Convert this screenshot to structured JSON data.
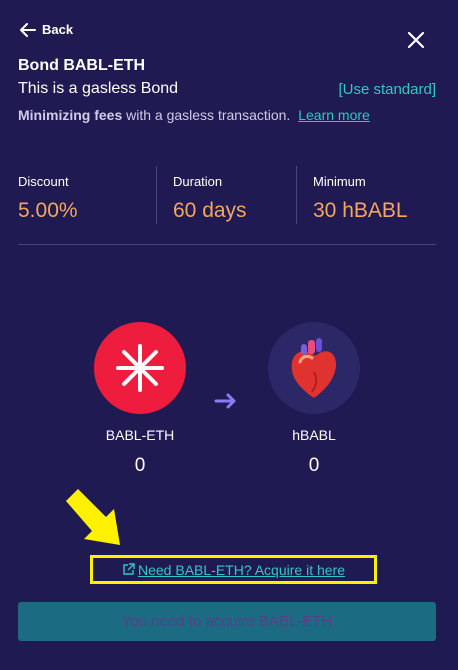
{
  "header": {
    "back_label": "Back",
    "title": "Bond BABL-ETH",
    "subtitle": "This is a gasless Bond",
    "use_standard_label": "[Use standard]"
  },
  "fees_note": {
    "bold": "Minimizing fees",
    "text": "with a gasless transaction.",
    "link": "Learn more"
  },
  "stats": [
    {
      "label": "Discount",
      "value": "5.00%"
    },
    {
      "label": "Duration",
      "value": "60 days"
    },
    {
      "label": "Minimum",
      "value": "30 hBABL"
    }
  ],
  "exchange": {
    "from": {
      "name": "BABL-ETH",
      "amount": "0",
      "icon": "babl-logo-icon"
    },
    "to": {
      "name": "hBABL",
      "amount": "0",
      "icon": "heart-logo-icon"
    }
  },
  "acquire_link": "Need BABL-ETH? Acquire it here",
  "action_button": "You need to acquire BABL-ETH",
  "colors": {
    "background": "#1f1a52",
    "accent": "#2ec9c4",
    "value": "#f5a65b",
    "highlight": "#fff100",
    "button": "#1b6b82",
    "babl_red": "#ee1c3d"
  }
}
